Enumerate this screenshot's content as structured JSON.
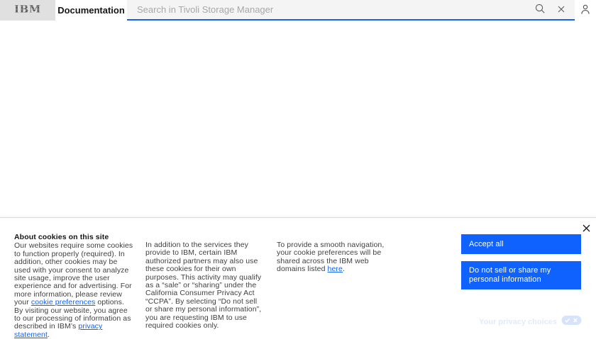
{
  "header": {
    "logo": "IBM",
    "product_label": "Documentation",
    "search_placeholder": "Search in Tivoli Storage Manager",
    "accent_color": "#0f62fe",
    "icons": {
      "search": "search-icon",
      "clear": "close-icon",
      "user": "user-icon"
    }
  },
  "cookie_banner": {
    "title": "About cookies on this site",
    "col1": {
      "text1": "Our websites require some cookies to function properly (required). In addition, other cookies may be used with your consent to analyze site usage, improve the user experience and for advertising. For more information, please review your ",
      "link1": "cookie preferences",
      "text2": " options. By visiting our website, you agree to our processing of information as described in IBM’s ",
      "link2": "privacy statement",
      "text3": "."
    },
    "col2": {
      "text": "In addition to the services they provide to IBM, certain IBM authorized partners may also use these cookies for their own purposes. This activity may qualify as a “sale” or “sharing” under the California Consumer Privacy Act “CCPA”. By selecting “Do not sell or share my personal information”, you are requesting IBM to use required cookies only."
    },
    "col3": {
      "text1": "To provide a smooth navigation, your cookie preferences will be shared across the IBM web domains listed ",
      "link": "here",
      "text2": "."
    },
    "accept_button": "Accept all",
    "do_not_sell_button": "Do not sell or share my personal information",
    "privacy_choices_label": "Your privacy choices",
    "button_color": "#0f62fe",
    "link_color": "#0f62fe"
  }
}
